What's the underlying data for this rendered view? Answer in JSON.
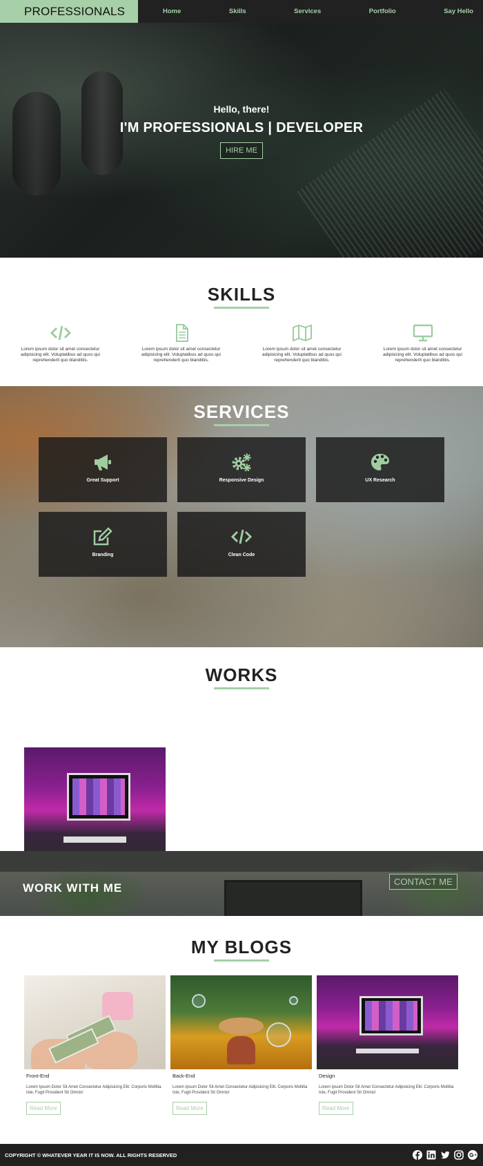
{
  "nav": {
    "brand": "PROFESSIONALS",
    "links": [
      "Home",
      "Skills",
      "Services",
      "Portfolio",
      "Say Hello"
    ]
  },
  "hero": {
    "greeting": "Hello, there!",
    "title": "I'M PROFESSIONALS | DEVELOPER",
    "button": "HIRE ME"
  },
  "skills": {
    "title": "SKILLS",
    "items": [
      {
        "icon": "code-icon",
        "text": "Lorem ipsum dolor sit amet consectetur adipisicing elit. Voluptatibus ad quos qui reprehenderit quo blanditiis."
      },
      {
        "icon": "file-icon",
        "text": "Lorem ipsum dolor sit amet consectetur adipisicing elit. Voluptatibus ad quos qui reprehenderit quo blanditiis."
      },
      {
        "icon": "map-icon",
        "text": "Lorem ipsum dolor sit amet consectetur adipisicing elit. Voluptatibus ad quos qui reprehenderit quo blanditiis."
      },
      {
        "icon": "desktop-icon",
        "text": "Lorem ipsum dolor sit amet consectetur adipisicing elit. Voluptatibus ad quos qui reprehenderit quo blanditiis."
      }
    ]
  },
  "services": {
    "title": "SERVICES",
    "items": [
      {
        "icon": "megaphone-icon",
        "label": "Great Support"
      },
      {
        "icon": "gears-icon",
        "label": "Responsive Design"
      },
      {
        "icon": "palette-icon",
        "label": "UX Research"
      },
      {
        "icon": "edit-icon",
        "label": "Branding"
      },
      {
        "icon": "code-icon",
        "label": "Clean Code"
      }
    ]
  },
  "works": {
    "title": "WORKS"
  },
  "contact": {
    "title": "WORK WITH ME",
    "button": "CONTACT ME"
  },
  "blogs": {
    "title": "MY BLOGS",
    "items": [
      {
        "category": "Front-End",
        "text": "Lorem Ipsum Dolor Sit Amet Consectetur Adipisicing Elit. Corporis Mollitia Iste, Fugit Provident Sit Omnis!",
        "button": "Read More"
      },
      {
        "category": "Back-End",
        "text": "Lorem Ipsum Dolor Sit Amet Consectetur Adipisicing Elit. Corporis Mollitia Iste, Fugit Provident Sit Omnis!",
        "button": "Read More"
      },
      {
        "category": "Design",
        "text": "Lorem Ipsum Dolor Sit Amet Consectetur Adipisicing Elit. Corporis Mollitia Iste, Fugit Provident Sit Omnis!",
        "button": "Read More"
      }
    ]
  },
  "footer": {
    "copyright": "COPYRIGHT © WHATEVER YEAR IT IS NOW. ALL RIGHTS RESERVED",
    "socials": [
      "facebook-icon",
      "linkedin-icon",
      "twitter-icon",
      "instagram-icon",
      "google-plus-icon"
    ]
  },
  "colors": {
    "accent": "#a7cfa8",
    "dark": "#212121"
  }
}
